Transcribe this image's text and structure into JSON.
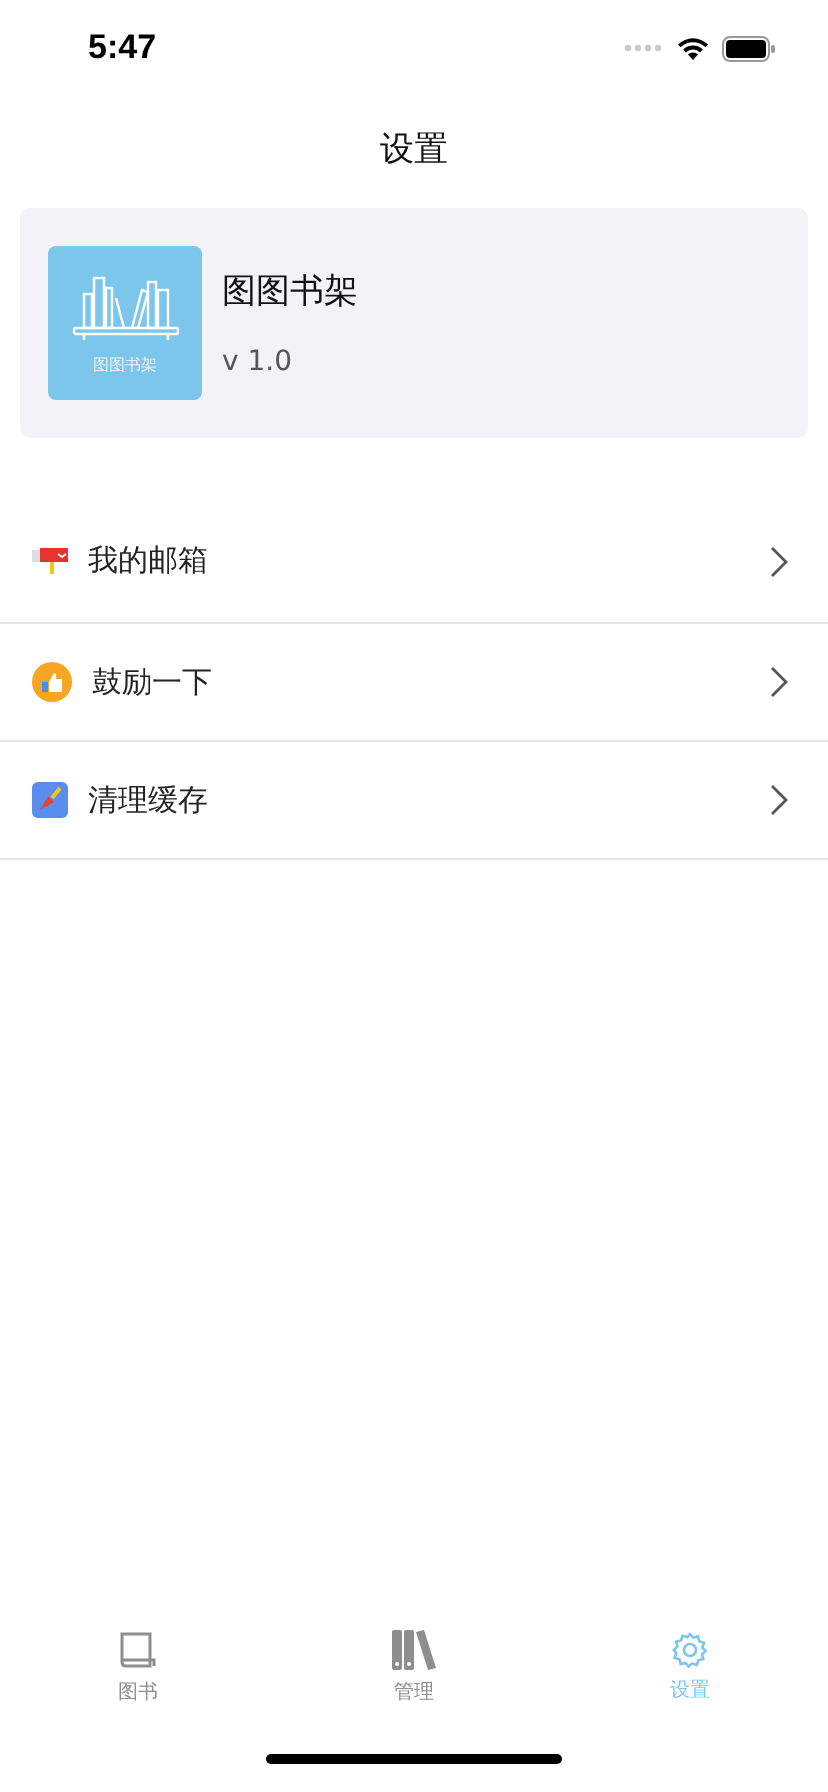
{
  "status_bar": {
    "time": "5:47"
  },
  "title": "设置",
  "app_card": {
    "logo_caption": "图图书架",
    "name": "图图书架",
    "version": "v 1.0"
  },
  "menu": [
    {
      "kind": "mailbox",
      "label": "我的邮箱"
    },
    {
      "kind": "thumbs",
      "label": "鼓励一下"
    },
    {
      "kind": "broom",
      "label": "清理缓存"
    }
  ],
  "tab_bar": [
    {
      "kind": "book",
      "label": "图书",
      "selected": false
    },
    {
      "kind": "binders",
      "label": "管理",
      "selected": false
    },
    {
      "kind": "gear",
      "label": "设置",
      "selected": true
    }
  ]
}
